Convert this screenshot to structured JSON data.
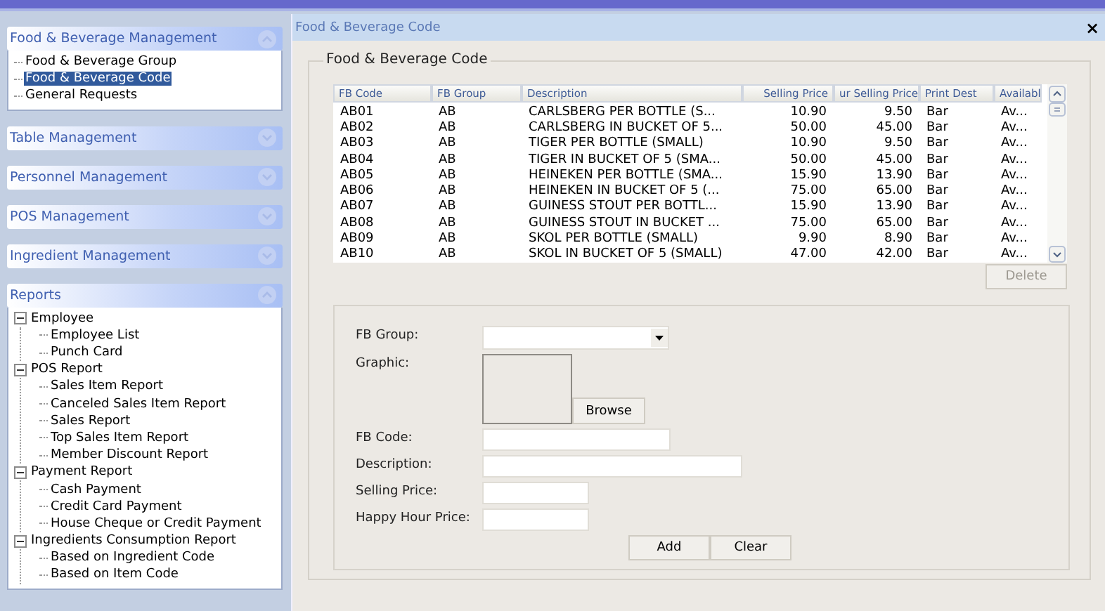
{
  "sidebar": {
    "sections": [
      {
        "title": "Food & Beverage Management",
        "expanded": true,
        "items": [
          {
            "label": "Food & Beverage Group",
            "selected": false
          },
          {
            "label": "Food & Beverage Code",
            "selected": true
          },
          {
            "label": "General Requests",
            "selected": false
          }
        ]
      },
      {
        "title": "Table Management",
        "expanded": false
      },
      {
        "title": "Personnel Management",
        "expanded": false
      },
      {
        "title": "POS Management",
        "expanded": false
      },
      {
        "title": "Ingredient Management",
        "expanded": false
      },
      {
        "title": "Reports",
        "expanded": true,
        "items": [
          {
            "label": "Employee",
            "selected": false,
            "expanded": true,
            "children": [
              {
                "label": "Employee List",
                "selected": false
              },
              {
                "label": "Punch Card",
                "selected": false
              }
            ]
          },
          {
            "label": "POS Report",
            "selected": false,
            "expanded": true,
            "children": [
              {
                "label": "Sales Item Report",
                "selected": false
              },
              {
                "label": "Canceled Sales Item Report",
                "selected": false
              },
              {
                "label": "Sales Report",
                "selected": false
              },
              {
                "label": "Top Sales Item Report",
                "selected": false
              },
              {
                "label": "Member Discount Report",
                "selected": false
              }
            ]
          },
          {
            "label": "Payment Report",
            "selected": false,
            "expanded": true,
            "children": [
              {
                "label": "Cash Payment",
                "selected": false
              },
              {
                "label": "Credit Card Payment",
                "selected": false
              },
              {
                "label": "House Cheque or Credit Payment",
                "selected": false
              }
            ]
          },
          {
            "label": "Ingredients Consumption Report",
            "selected": false,
            "expanded": true,
            "children": [
              {
                "label": "Based on Ingredient Code",
                "selected": false
              },
              {
                "label": "Based on Item Code",
                "selected": false
              }
            ]
          }
        ]
      }
    ]
  },
  "window": {
    "title": "Food & Beverage Code",
    "close": "×",
    "group_title": "Food & Beverage Code",
    "table": {
      "columns": [
        {
          "label": "FB Code",
          "kind": "text"
        },
        {
          "label": "FB Group",
          "kind": "text"
        },
        {
          "label": "Description",
          "kind": "text"
        },
        {
          "label": "Selling Price",
          "kind": "number"
        },
        {
          "label": "ur Selling Price",
          "kind": "number"
        },
        {
          "label": "Print Dest",
          "kind": "text"
        },
        {
          "label": "Availabl",
          "kind": "text"
        }
      ],
      "rows": [
        [
          "AB01",
          "AB",
          "CARLSBERG PER BOTTLE (S...",
          "10.90",
          "9.50",
          "Bar",
          "Av..."
        ],
        [
          "AB02",
          "AB",
          "CARLSBERG IN BUCKET OF 5...",
          "50.00",
          "45.00",
          "Bar",
          "Av..."
        ],
        [
          "AB03",
          "AB",
          "TIGER PER BOTTLE (SMALL)",
          "10.90",
          "9.50",
          "Bar",
          "Av..."
        ],
        [
          "AB04",
          "AB",
          "TIGER IN BUCKET OF 5 (SMA...",
          "50.00",
          "45.00",
          "Bar",
          "Av..."
        ],
        [
          "AB05",
          "AB",
          "HEINEKEN PER BOTTLE (SMA...",
          "15.90",
          "13.90",
          "Bar",
          "Av..."
        ],
        [
          "AB06",
          "AB",
          "HEINEKEN IN BUCKET OF 5 (...",
          "75.00",
          "65.00",
          "Bar",
          "Av..."
        ],
        [
          "AB07",
          "AB",
          "GUINESS STOUT PER BOTTL...",
          "15.90",
          "13.90",
          "Bar",
          "Av..."
        ],
        [
          "AB08",
          "AB",
          "GUINESS STOUT IN BUCKET ...",
          "75.00",
          "65.00",
          "Bar",
          "Av..."
        ],
        [
          "AB09",
          "AB",
          "SKOL PER BOTTLE (SMALL)",
          "9.90",
          "8.90",
          "Bar",
          "Av..."
        ],
        [
          "AB10",
          "AB",
          "SKOL IN BUCKET OF 5 (SMALL)",
          "47.00",
          "42.00",
          "Bar",
          "Av..."
        ]
      ]
    },
    "delete_button": {
      "label": "Delete",
      "disabled": true
    },
    "form": {
      "fields": [
        {
          "label": "FB Group:",
          "kind": "dropdown"
        },
        {
          "label": "Graphic:",
          "kind": "image",
          "button": "Browse"
        },
        {
          "label": "FB Code:",
          "kind": "text"
        },
        {
          "label": "Description:",
          "kind": "text"
        },
        {
          "label": "Selling Price:",
          "kind": "text"
        },
        {
          "label": "Happy Hour Price:",
          "kind": "text"
        }
      ],
      "buttons": [
        "Add",
        "Clear"
      ]
    }
  }
}
